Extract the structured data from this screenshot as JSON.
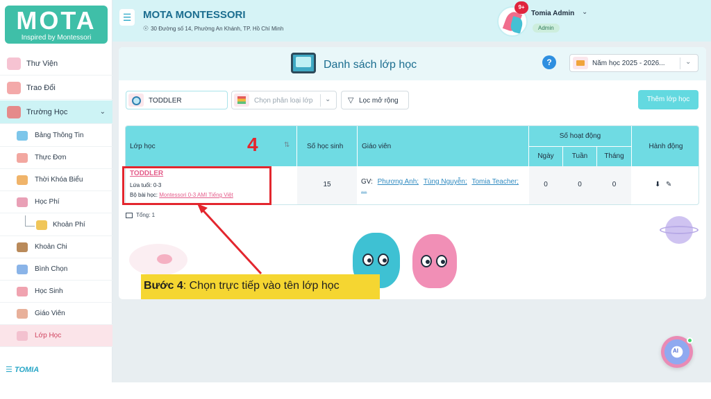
{
  "brand": {
    "logo_title": "MOTA",
    "logo_tagline": "Inspired by Montessori",
    "footer_brand": "TOMIA"
  },
  "header": {
    "org_name": "MOTA MONTESSORI",
    "org_address": "30 Đường số 14, Phường An Khánh, TP. Hồ Chí Minh",
    "notification_count": "9+",
    "user_name": "Tomia Admin",
    "user_role": "Admin"
  },
  "sidebar": {
    "main_items": [
      {
        "label": "Thư Viện",
        "icon": "library-icon"
      },
      {
        "label": "Trao Đổi",
        "icon": "chat-icon"
      },
      {
        "label": "Trường Học",
        "icon": "school-icon"
      }
    ],
    "sub_items": [
      {
        "label": "Bảng Thông Tin",
        "icon": "megaphone-icon"
      },
      {
        "label": "Thực Đơn",
        "icon": "menu-board-icon"
      },
      {
        "label": "Thời Khóa Biểu",
        "icon": "timetable-icon"
      },
      {
        "label": "Học Phí",
        "icon": "tuition-icon"
      },
      {
        "label": "Khoản Phí",
        "icon": "fee-icon"
      },
      {
        "label": "Khoản Chi",
        "icon": "wallet-icon"
      },
      {
        "label": "Bình Chọn",
        "icon": "poll-icon"
      },
      {
        "label": "Học Sinh",
        "icon": "students-icon"
      },
      {
        "label": "Giáo Viên",
        "icon": "teachers-icon"
      },
      {
        "label": "Lớp Học",
        "icon": "classroom-icon"
      }
    ],
    "selected": "Lớp Học"
  },
  "page": {
    "title": "Danh sách lớp học",
    "help": "?",
    "year_select": "Năm học 2025 - 2026...",
    "search_value": "TODDLER",
    "classify_placeholder": "Chọn phân loại lớp",
    "filter_label": "Lọc mở rộng",
    "add_button": "Thêm lớp học",
    "total": "Tổng: 1"
  },
  "table": {
    "headers": {
      "class": "Lớp học",
      "students": "Số học sinh",
      "teacher": "Giáo viên",
      "activity": "Số hoạt động",
      "day": "Ngày",
      "week": "Tuần",
      "month": "Tháng",
      "action": "Hành động"
    },
    "rows": [
      {
        "name": "TODDLER",
        "age": "Lứa tuổi: 0-3",
        "curriculum_label": "Bộ bài học:",
        "curriculum": "Montessori 0-3 AMI Tiếng Việt",
        "students": "15",
        "teacher_prefix": "GV:",
        "teachers": [
          "Phương Anh;",
          "Tùng Nguyễn;",
          "Tomia Teacher;"
        ],
        "teacher_more": "...",
        "day": "0",
        "week": "0",
        "month": "0"
      }
    ]
  },
  "annotation": {
    "step_number": "4",
    "step_prefix": "Bước 4",
    "step_text": ": Chọn trực tiếp vào tên lớp học",
    "color": "#e3262e"
  },
  "ai_assistant": {
    "label": "AI"
  }
}
